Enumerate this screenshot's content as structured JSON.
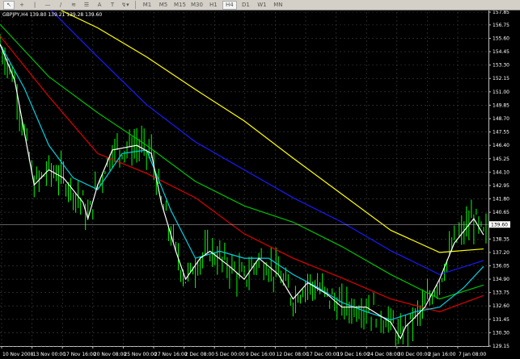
{
  "toolbar": {
    "tools": [
      {
        "name": "cursor-icon",
        "glyph": "↖"
      },
      {
        "name": "crosshair-icon",
        "glyph": "+"
      },
      {
        "name": "vertical-line-icon",
        "glyph": "|"
      },
      {
        "name": "horizontal-line-icon",
        "glyph": "—"
      },
      {
        "name": "trendline-icon",
        "glyph": "/"
      },
      {
        "name": "fibonacci-icon",
        "glyph": "≋"
      },
      {
        "name": "channel-icon",
        "glyph": "☰"
      },
      {
        "name": "text-icon",
        "glyph": "A"
      },
      {
        "name": "text-label-icon",
        "glyph": "T"
      },
      {
        "name": "arrows-icon",
        "glyph": "↯▾"
      }
    ],
    "timeframes": [
      "M1",
      "M5",
      "M15",
      "M30",
      "H1",
      "H4",
      "D1",
      "W1",
      "MN"
    ],
    "active_timeframe": "H4"
  },
  "chart_title": "GBPJPY,H4  139.80 139.21 139.28 139.60",
  "chart_data": {
    "type": "line",
    "symbol": "GBPJPY",
    "timeframe": "H4",
    "ohlc": {
      "open": 139.8,
      "high": 139.21,
      "low": 139.28,
      "close": 139.6
    },
    "current_price": "139.60",
    "ylim": [
      129.15,
      157.85
    ],
    "y_ticks": [
      "157.85",
      "156.75",
      "155.60",
      "154.45",
      "153.30",
      "152.15",
      "151.00",
      "149.85",
      "148.70",
      "147.55",
      "146.40",
      "145.25",
      "144.10",
      "142.95",
      "141.80",
      "140.65",
      "138.35",
      "137.20",
      "136.05",
      "134.90",
      "133.75",
      "132.60",
      "131.45",
      "130.30",
      "129.15"
    ],
    "x_ticks": [
      "10 Nov 2008",
      "13 Nov 00:00",
      "17 Nov 16:00",
      "20 Nov 08:00",
      "25 Nov 00:00",
      "27 Nov 16:00",
      "2 Dec 08:00",
      "5 Dec 00:00",
      "9 Dec 16:00",
      "12 Dec 08:00",
      "17 Dec 00:00",
      "19 Dec 16:00",
      "24 Dec 08:00",
      "30 Dec 00:00",
      "2 Jan 16:00",
      "7 Jan 08:00"
    ],
    "xlim": [
      0,
      100
    ],
    "series": [
      {
        "name": "ma-yellow",
        "color": "#ffff00",
        "points": [
          [
            0,
            160.9
          ],
          [
            10,
            158.5
          ],
          [
            20,
            156.5
          ],
          [
            30,
            154.0
          ],
          [
            40,
            151.2
          ],
          [
            50,
            148.5
          ],
          [
            60,
            145.3
          ],
          [
            70,
            142.2
          ],
          [
            80,
            139.1
          ],
          [
            90,
            137.2
          ],
          [
            99,
            137.5
          ]
        ]
      },
      {
        "name": "ma-blue",
        "color": "#1a1aff",
        "points": [
          [
            0,
            161.5
          ],
          [
            10,
            158.2
          ],
          [
            20,
            154.0
          ],
          [
            30,
            149.9
          ],
          [
            40,
            146.7
          ],
          [
            50,
            144.3
          ],
          [
            60,
            141.9
          ],
          [
            70,
            139.8
          ],
          [
            80,
            137.35
          ],
          [
            90,
            135.3
          ],
          [
            99,
            136.5
          ]
        ]
      },
      {
        "name": "ma-green",
        "color": "#00c000",
        "points": [
          [
            0,
            156.8
          ],
          [
            10,
            152.3
          ],
          [
            20,
            149.2
          ],
          [
            30,
            146.4
          ],
          [
            40,
            143.3
          ],
          [
            50,
            141.2
          ],
          [
            60,
            139.8
          ],
          [
            70,
            137.7
          ],
          [
            80,
            135.3
          ],
          [
            90,
            133.2
          ],
          [
            99,
            134.4
          ]
        ]
      },
      {
        "name": "ma-red",
        "color": "#e00000",
        "points": [
          [
            0,
            155.8
          ],
          [
            10,
            150.6
          ],
          [
            20,
            145.7
          ],
          [
            30,
            144.0
          ],
          [
            40,
            141.9
          ],
          [
            50,
            138.8
          ],
          [
            60,
            136.7
          ],
          [
            70,
            135.0
          ],
          [
            80,
            133.2
          ],
          [
            90,
            132.1
          ],
          [
            99,
            133.5
          ]
        ]
      },
      {
        "name": "ma-cyan",
        "color": "#00d0e0",
        "points": [
          [
            0,
            155.1
          ],
          [
            5,
            151.3
          ],
          [
            10,
            146.4
          ],
          [
            15,
            143.6
          ],
          [
            20,
            142.6
          ],
          [
            25,
            145.7
          ],
          [
            30,
            146.0
          ],
          [
            35,
            140.8
          ],
          [
            40,
            136.7
          ],
          [
            45,
            137.3
          ],
          [
            50,
            136.7
          ],
          [
            55,
            136.7
          ],
          [
            60,
            135.3
          ],
          [
            65,
            134.2
          ],
          [
            70,
            132.9
          ],
          [
            75,
            132.1
          ],
          [
            80,
            131.4
          ],
          [
            85,
            132.1
          ],
          [
            90,
            132.5
          ],
          [
            95,
            134.2
          ],
          [
            99,
            136.0
          ]
        ]
      },
      {
        "name": "ma-white",
        "color": "#ffffff",
        "points": [
          [
            0,
            155.1
          ],
          [
            3,
            152.0
          ],
          [
            7,
            143.0
          ],
          [
            10,
            144.3
          ],
          [
            13,
            143.6
          ],
          [
            17,
            141.5
          ],
          [
            18,
            140.1
          ],
          [
            20,
            143.0
          ],
          [
            23,
            146.0
          ],
          [
            28,
            146.4
          ],
          [
            31,
            145.7
          ],
          [
            33,
            141.5
          ],
          [
            36,
            137.3
          ],
          [
            38,
            134.9
          ],
          [
            41,
            136.7
          ],
          [
            43,
            137.3
          ],
          [
            47,
            136.0
          ],
          [
            50,
            134.9
          ],
          [
            53,
            136.7
          ],
          [
            57,
            135.3
          ],
          [
            60,
            133.2
          ],
          [
            63,
            134.6
          ],
          [
            67,
            133.6
          ],
          [
            70,
            132.5
          ],
          [
            75,
            132.5
          ],
          [
            80,
            131.2
          ],
          [
            82,
            129.8
          ],
          [
            83,
            130.8
          ],
          [
            87,
            132.5
          ],
          [
            90,
            134.9
          ],
          [
            93,
            138.0
          ],
          [
            97,
            140.1
          ],
          [
            99,
            138.7
          ]
        ]
      }
    ],
    "candles_color": "#00ff00"
  }
}
